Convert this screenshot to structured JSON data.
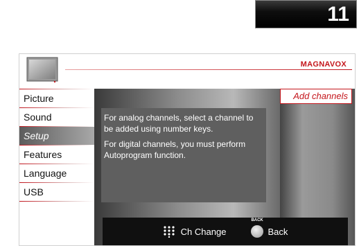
{
  "channel": {
    "number": "11"
  },
  "header": {
    "brand": "MAGNAVOX"
  },
  "sidebar": {
    "items": [
      {
        "label": "Picture",
        "selected": false
      },
      {
        "label": "Sound",
        "selected": false
      },
      {
        "label": "Setup",
        "selected": true
      },
      {
        "label": "Features",
        "selected": false
      },
      {
        "label": "Language",
        "selected": false
      },
      {
        "label": "USB",
        "selected": false
      }
    ]
  },
  "submenu": {
    "selected_label": "Add channels"
  },
  "info": {
    "line1": "For analog channels, select a channel to be added using number keys.",
    "line2": "For digital channels, you must perform Autoprogram function."
  },
  "footer": {
    "ch_change_label": "Ch Change",
    "back_caption": "BACK",
    "back_label": "Back"
  },
  "colors": {
    "accent": "#c4161c",
    "panel_dark": "#5f5f5f",
    "footer": "#101010"
  }
}
